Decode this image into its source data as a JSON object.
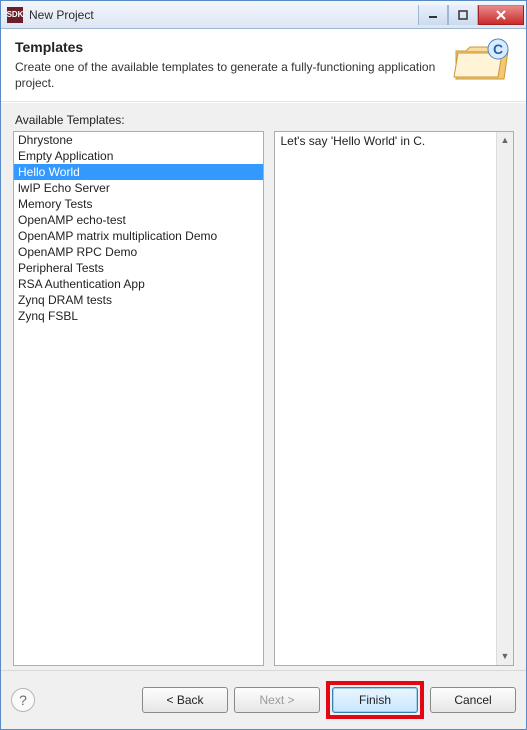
{
  "window": {
    "title": "New Project"
  },
  "header": {
    "title": "Templates",
    "description": "Create one of the available templates to generate a fully-functioning application project."
  },
  "sectionLabel": "Available Templates:",
  "templates": {
    "selectedIndex": 2,
    "items": [
      "Dhrystone",
      "Empty Application",
      "Hello World",
      "lwIP Echo Server",
      "Memory Tests",
      "OpenAMP echo-test",
      "OpenAMP matrix multiplication Demo",
      "OpenAMP RPC Demo",
      "Peripheral Tests",
      "RSA Authentication App",
      "Zynq DRAM tests",
      "Zynq FSBL"
    ]
  },
  "description": "Let's say 'Hello World' in C.",
  "buttons": {
    "back": "< Back",
    "next": "Next >",
    "finish": "Finish",
    "cancel": "Cancel"
  }
}
